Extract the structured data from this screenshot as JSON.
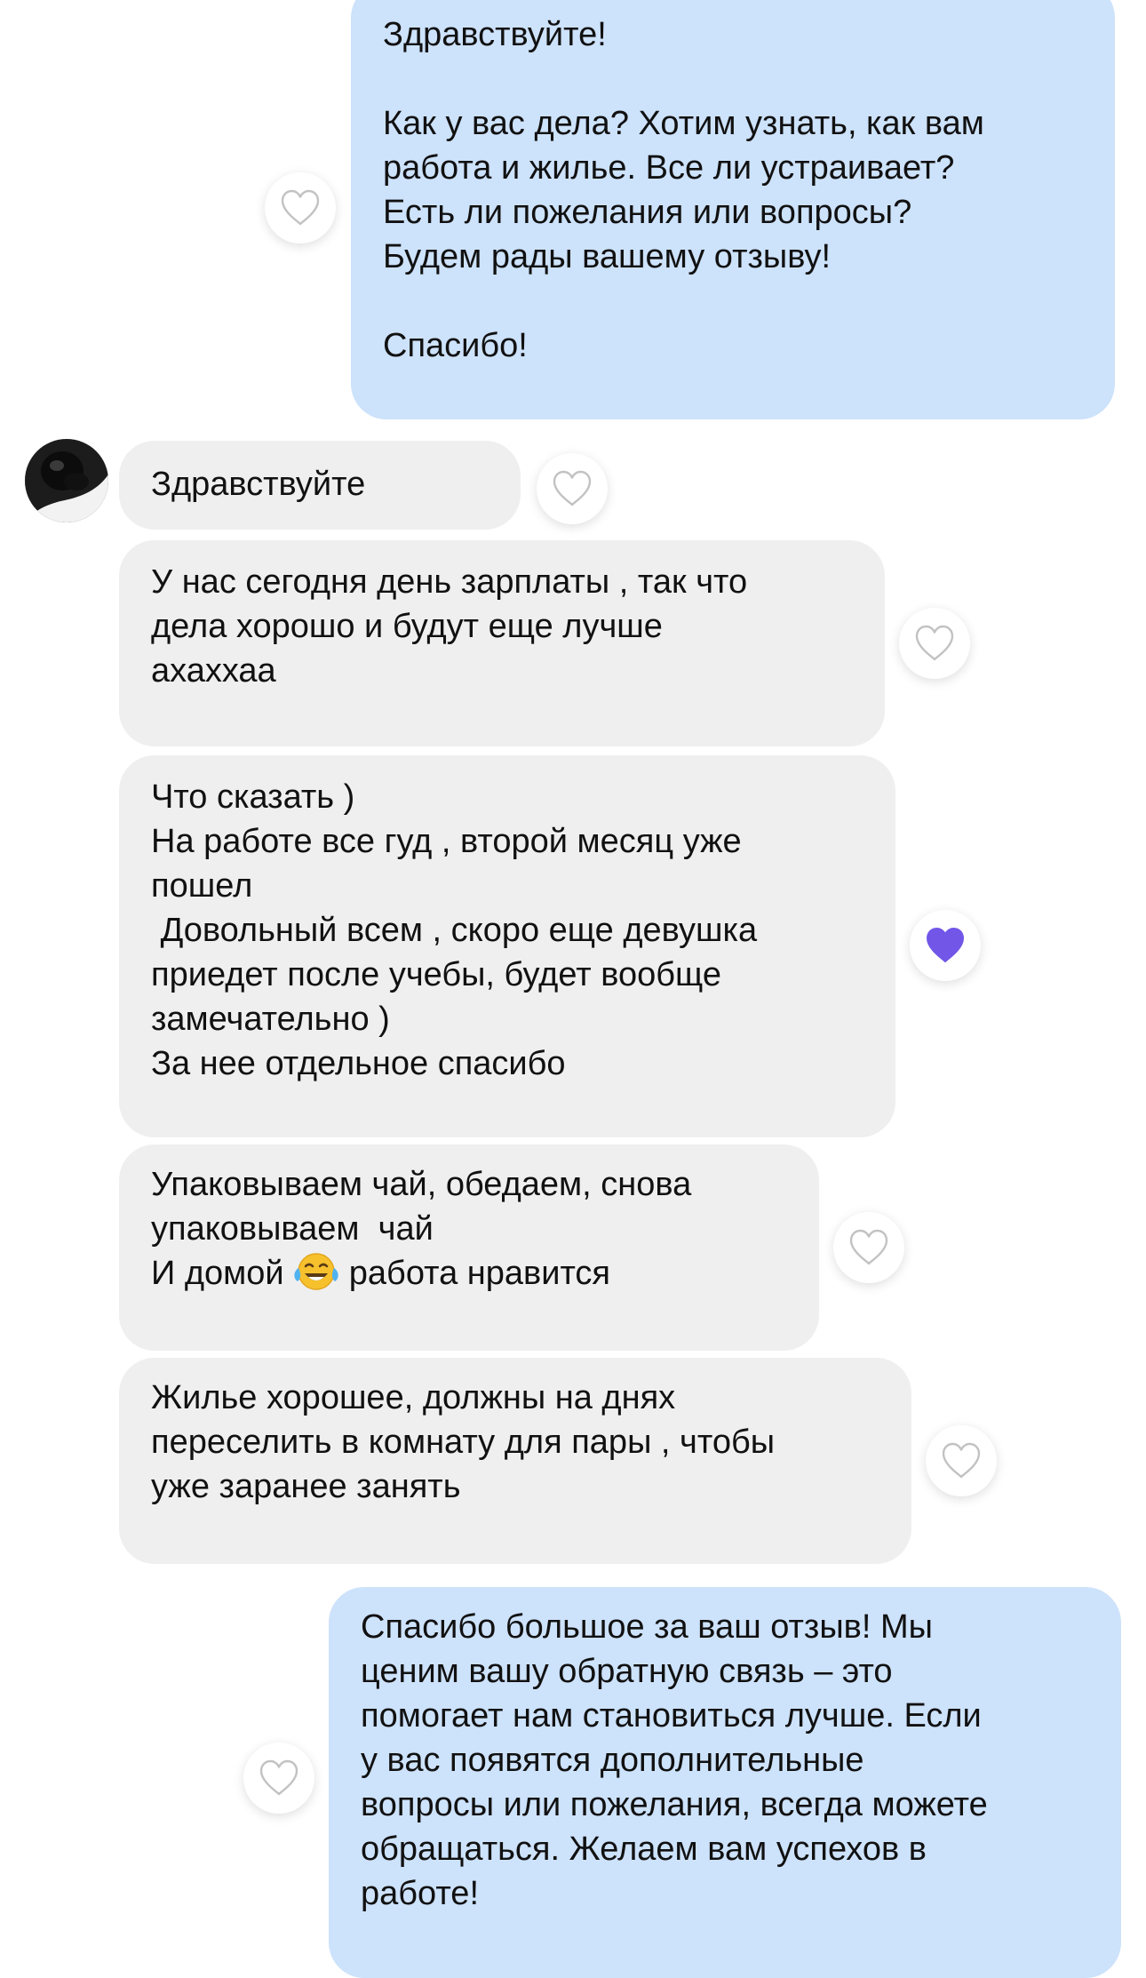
{
  "chat": {
    "avatar_icon": "contact-avatar",
    "reaction_icon": "heart-icon",
    "reaction_color_active": "#7156e8",
    "outgoing_bubble_color": "#cde2fb",
    "incoming_bubble_color": "#efefef",
    "messages": [
      {
        "direction": "outgoing",
        "text": "Здравствуйте!\n\nКак у вас дела? Хотим узнать, как вам\nработа и жилье. Все ли устраивает?\nЕсть ли пожелания или вопросы?\nБудем рады вашему отзыву!\n\nСпасибо!",
        "liked": false
      },
      {
        "direction": "incoming",
        "text": "Здравствуйте",
        "liked": false
      },
      {
        "direction": "incoming",
        "text": "У нас сегодня день зарплаты , так что\nдела хорошо и будут еще лучше\nахаххаа",
        "liked": false
      },
      {
        "direction": "incoming",
        "text": "Что сказать )\nНа работе все гуд , второй месяц уже\nпошел\n Довольный всем , скоро еще девушка\nприедет после учебы, будет вообще\nзамечательно )\nЗа нее отдельное спасибо",
        "liked": true
      },
      {
        "direction": "incoming",
        "text_line1": "Упаковываем чай, обедаем, снова",
        "text_line2": "упаковываем  чай",
        "text_line3_before": "И домой ",
        "emoji": "face-with-tears-of-joy-emoji",
        "text_line3_after": " работа нравится",
        "liked": false
      },
      {
        "direction": "incoming",
        "text": "Жилье хорошее, должны на днях\nпереселить в комнату для пары , чтобы\nуже заранее занять",
        "liked": false
      },
      {
        "direction": "outgoing",
        "text": "Спасибо большое за ваш отзыв! Мы\nценим вашу обратную связь – это\nпомогает нам становиться лучше. Если\nу вас появятся дополнительные\nвопросы или пожелания, всегда можете\nобращаться. Желаем вам успехов в\nработе!",
        "liked": false
      }
    ]
  }
}
